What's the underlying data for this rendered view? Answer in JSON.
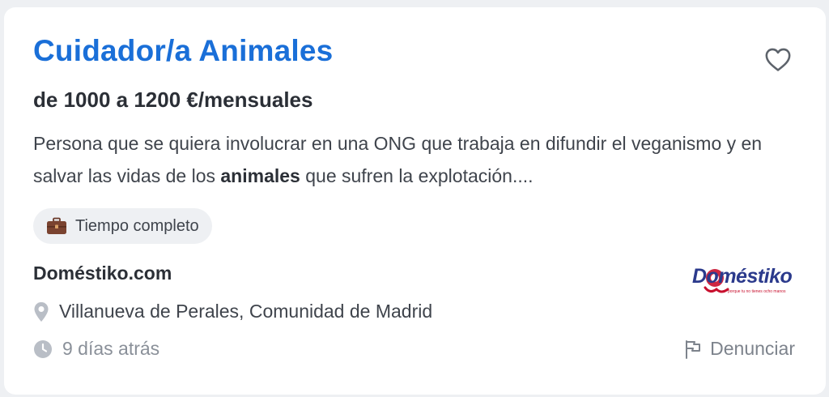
{
  "job": {
    "title": "Cuidador/a Animales",
    "salary": "de 1000 a 1200 €/mensuales",
    "description_before": "Persona que se quiera involucrar en una ONG que trabaja en difundir el veganismo y en salvar las vidas de los ",
    "description_highlight": "animales",
    "description_after": " que sufren la explotación....",
    "contract_tag": "Tiempo completo",
    "company": "Doméstiko.com",
    "location": "Villanueva de Perales, Comunidad de Madrid",
    "posted": "9 días atrás",
    "report_label": "Denunciar"
  },
  "logo": {
    "wordmark": "Doméstiko",
    "tagline": "porque tu no tienes ocho manos"
  },
  "icons": {
    "favorite": "heart-outline-icon",
    "tag": "briefcase-icon",
    "location": "map-pin-icon",
    "time": "clock-icon",
    "report": "flag-icon"
  },
  "colors": {
    "title": "#1a6fd8",
    "text_dark": "#2b2f36",
    "text_muted": "#8a9099",
    "logo_blue": "#2b3a8c",
    "logo_red": "#c8102e"
  }
}
